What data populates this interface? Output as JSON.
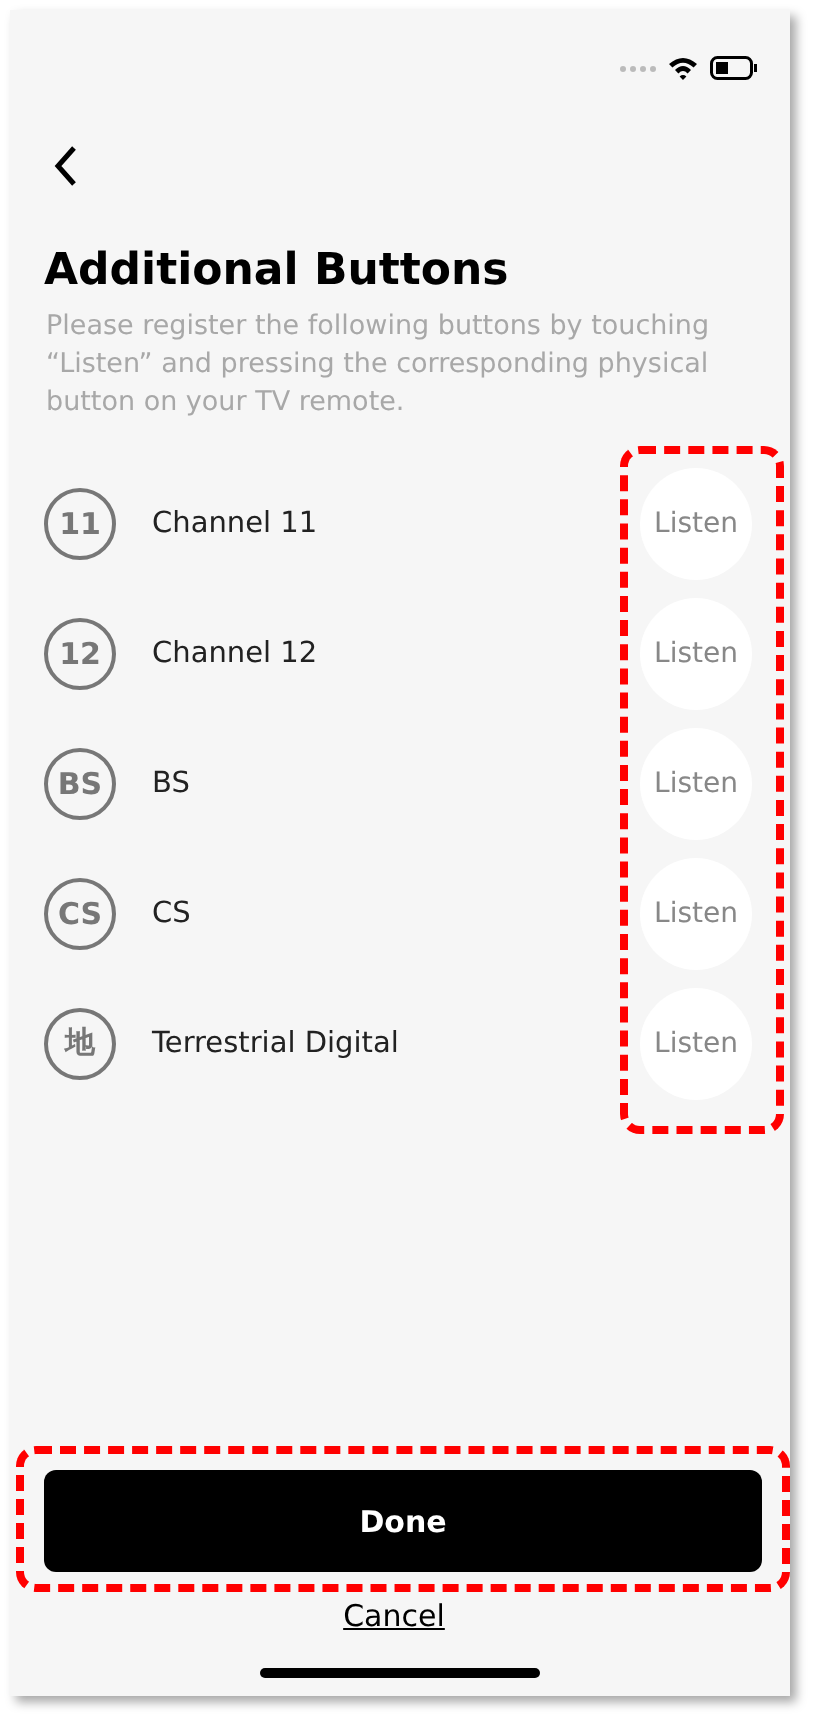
{
  "header": {
    "title": "Additional Buttons",
    "description": "Please register the following buttons by touching “Listen” and pressing the corresponding physical button on your TV remote."
  },
  "buttons": [
    {
      "badge": "11",
      "label": "Channel 11",
      "action": "Listen"
    },
    {
      "badge": "12",
      "label": "Channel 12",
      "action": "Listen"
    },
    {
      "badge": "BS",
      "label": "BS",
      "action": "Listen"
    },
    {
      "badge": "CS",
      "label": "CS",
      "action": "Listen"
    },
    {
      "badge": "地",
      "label": "Terrestrial Digital",
      "action": "Listen"
    }
  ],
  "listen_highlighted": true,
  "done": {
    "label": "Done",
    "highlighted": true
  },
  "cancel": {
    "label": "Cancel"
  }
}
